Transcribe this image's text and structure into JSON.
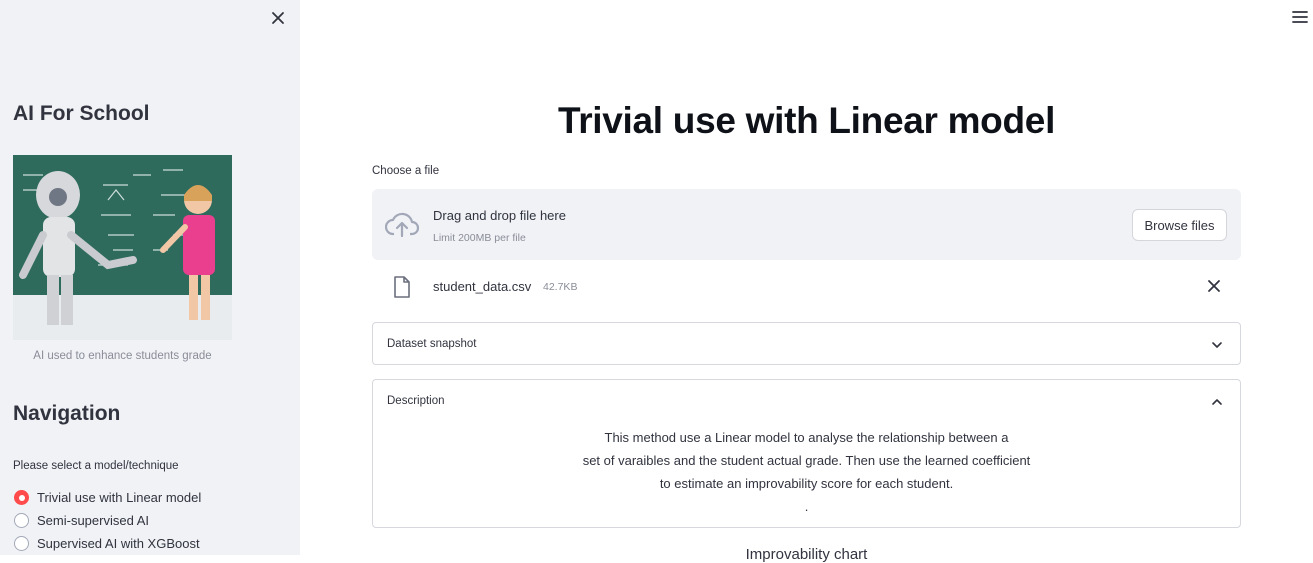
{
  "sidebar": {
    "title": "AI For School",
    "image_caption": "AI used to enhance students grade",
    "nav_title": "Navigation",
    "radio_label": "Please select a model/technique",
    "options": [
      {
        "label": "Trivial use with Linear model",
        "selected": true
      },
      {
        "label": "Semi-supervised AI",
        "selected": false
      },
      {
        "label": "Supervised AI with XGBoost",
        "selected": false
      }
    ]
  },
  "main": {
    "title": "Trivial use with Linear model",
    "uploader": {
      "label": "Choose a file",
      "drop_text": "Drag and drop file here",
      "limit_text": "Limit 200MB per file",
      "browse_label": "Browse files"
    },
    "file": {
      "name": "student_data.csv",
      "size": "42.7KB"
    },
    "expanders": [
      {
        "title": "Dataset snapshot",
        "expanded": false
      },
      {
        "title": "Description",
        "expanded": true,
        "lines": [
          "This method use a Linear model to analyse the relationship between a",
          "set of varaibles and the student actual grade. Then use the learned coefficient",
          "to estimate an improvability score for each student.",
          "."
        ]
      }
    ],
    "next_heading_partial": "Improvability chart"
  },
  "colors": {
    "accent": "#ff4b4b",
    "sidebar_bg": "#f0f2f6",
    "dropzone_bg": "#f0f2f6"
  }
}
